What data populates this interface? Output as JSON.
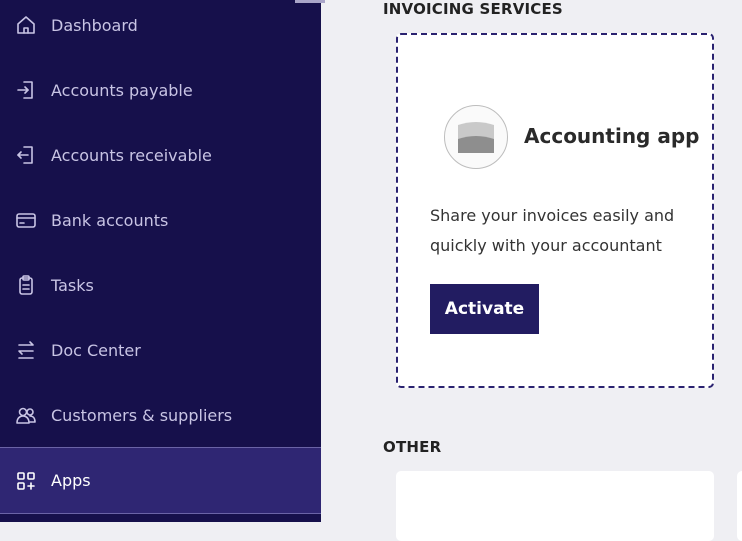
{
  "sidebar": {
    "items": [
      {
        "label": "Dashboard",
        "icon": "home-icon"
      },
      {
        "label": "Accounts payable",
        "icon": "login-icon"
      },
      {
        "label": "Accounts receivable",
        "icon": "logout-icon"
      },
      {
        "label": "Bank accounts",
        "icon": "credit-card-icon"
      },
      {
        "label": "Tasks",
        "icon": "clipboard-icon"
      },
      {
        "label": "Doc Center",
        "icon": "doc-transfer-icon"
      },
      {
        "label": "Customers & suppliers",
        "icon": "users-icon"
      },
      {
        "label": "Apps",
        "icon": "apps-icon",
        "active": true
      }
    ]
  },
  "main": {
    "invoicing_title": "INVOICING SERVICES",
    "app_card": {
      "name": "Accounting app",
      "description": "Share your invoices easily and quickly with your accountant",
      "button_label": "Activate",
      "icon": "app-logo-icon"
    },
    "other_title": "OTHER"
  },
  "colors": {
    "sidebar_bg": "#16104b",
    "active_item_bg": "#2f2673",
    "button_bg": "#221c61",
    "card_border": "#2a2270"
  }
}
